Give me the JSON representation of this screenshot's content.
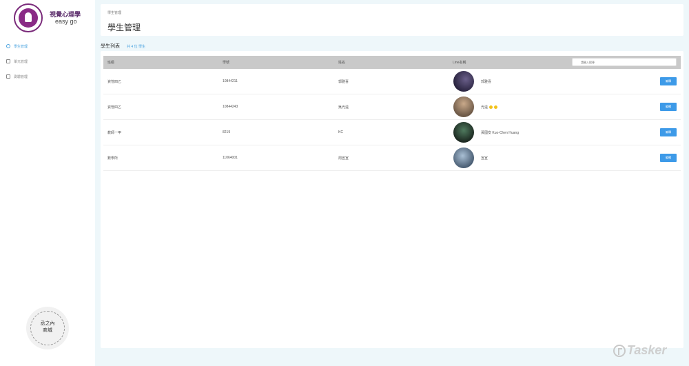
{
  "brand": {
    "title": "視覺心理學",
    "subtitle": "easy go"
  },
  "sidebar": {
    "items": [
      {
        "label": "學生管理",
        "icon": "user-icon",
        "active": true
      },
      {
        "label": "單元管理",
        "icon": "document-icon",
        "active": false
      },
      {
        "label": "測驗管理",
        "icon": "grid-icon",
        "active": false
      }
    ]
  },
  "seal": {
    "text_line1": "丞之內",
    "text_line2": "商城"
  },
  "header": {
    "breadcrumb": "學生管理",
    "title": "學生管理"
  },
  "list": {
    "title": "學生列表",
    "count_text": "共 4 位 學生"
  },
  "table": {
    "columns": [
      "班級",
      "學號",
      "姓名",
      "Line名稱"
    ],
    "search_placeholder": "請輸入搜尋",
    "edit_label": "編輯",
    "rows": [
      {
        "class": "資管四乙",
        "id": "10844211",
        "name": "郭雅喜",
        "line": "郭雅喜",
        "avatar_color": "#3b3350"
      },
      {
        "class": "資管四乙",
        "id": "10844243",
        "name": "吳光遠",
        "line": "光遠",
        "avatar_color": "#8a7560",
        "emoji": true
      },
      {
        "class": "教師一甲",
        "id": "8219",
        "name": "KC",
        "line": "黃國安 Kuo-Chen Huang",
        "avatar_color": "#2e4a3a"
      },
      {
        "class": "數學所",
        "id": "11064001",
        "name": "周宣宣",
        "line": "宣宣",
        "avatar_color": "#7a8fa6"
      }
    ]
  },
  "watermark": {
    "text": "Tasker"
  },
  "colors": {
    "accent": "#4aa3df",
    "button": "#3d9ae8",
    "background": "#eef7fa"
  }
}
